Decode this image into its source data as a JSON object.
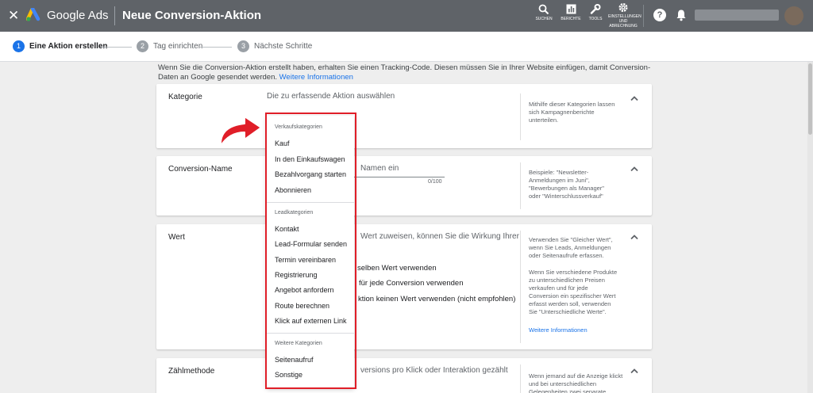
{
  "header": {
    "close_icon": "close-icon",
    "brand": "Google Ads",
    "title": "Neue Conversion-Aktion",
    "tools": [
      {
        "label": "SUCHEN",
        "icon": "search-icon"
      },
      {
        "label": "BERICHTE",
        "icon": "reports-icon"
      },
      {
        "label": "TOOLS",
        "icon": "wrench-icon"
      },
      {
        "label": "EINSTELLUNGEN UND ABRECHNUNG",
        "icon": "gear-icon"
      }
    ],
    "help_label": "?",
    "bell_icon": "bell-icon"
  },
  "stepper": {
    "steps": [
      {
        "num": "1",
        "label": "Eine Aktion erstellen",
        "active": true
      },
      {
        "num": "2",
        "label": "Tag einrichten",
        "active": false
      },
      {
        "num": "3",
        "label": "Nächste Schritte",
        "active": false
      }
    ]
  },
  "intro": {
    "text": "Wenn Sie die Conversion-Aktion erstellt haben, erhalten Sie einen Tracking-Code. Diesen müssen Sie in Ihrer Website einfügen, damit Conversion-Daten an Google gesendet werden.",
    "link": "Weitere Informationen"
  },
  "cards": {
    "kategorie": {
      "title": "Kategorie",
      "placeholder": "Die zu erfassende Aktion auswählen",
      "help": "Mithilfe dieser Kategorien lassen sich Kampagnenberichte unterteilen."
    },
    "conversion_name": {
      "title": "Conversion-Name",
      "input_partial": "Namen ein",
      "counter": "0/100",
      "help": "Beispiele: \"Newsletter-Anmeldungen im Juni\", \"Bewerbungen als Manager\" oder \"Winterschlussverkauf\""
    },
    "wert": {
      "title": "Wert",
      "description_partial": "Wert zuweisen, können Sie die Wirkung Ihrer",
      "options_partial": [
        "selben Wert verwenden",
        "für jede Conversion verwenden",
        "ktion keinen Wert verwenden (nicht empfohlen)"
      ],
      "help_1": "Verwenden Sie \"Gleicher Wert\", wenn Sie Leads, Anmeldungen oder Seitenaufrufe erfassen.",
      "help_2": "Wenn Sie verschiedene Produkte zu unterschiedlichen Preisen verkaufen und für jede Conversion ein spezifischer Wert erfasst werden soll, verwenden Sie \"Unterschiedliche Werte\".",
      "help_link": "Weitere Informationen"
    },
    "zaehlmethode": {
      "title": "Zählmethode",
      "description_partial": "versions pro Klick oder Interaktion gezählt",
      "help": "Wenn jemand auf die Anzeige klickt und bei unterschiedlichen Gelegenheiten zwei separate"
    }
  },
  "menu": {
    "groups": [
      {
        "header": "Verkaufskategorien",
        "items": [
          "Kauf",
          "In den Einkaufswagen",
          "Bezahlvorgang starten",
          "Abonnieren"
        ]
      },
      {
        "header": "Leadkategorien",
        "items": [
          "Kontakt",
          "Lead-Formular senden",
          "Termin vereinbaren",
          "Registrierung",
          "Angebot anfordern",
          "Route berechnen",
          "Klick auf externen Link"
        ]
      },
      {
        "header": "Weitere Kategorien",
        "items": [
          "Seitenaufruf",
          "Sonstige"
        ]
      }
    ]
  },
  "colors": {
    "topbar": "#5f6368",
    "accent": "#1a73e8",
    "highlight": "#e01e28"
  }
}
